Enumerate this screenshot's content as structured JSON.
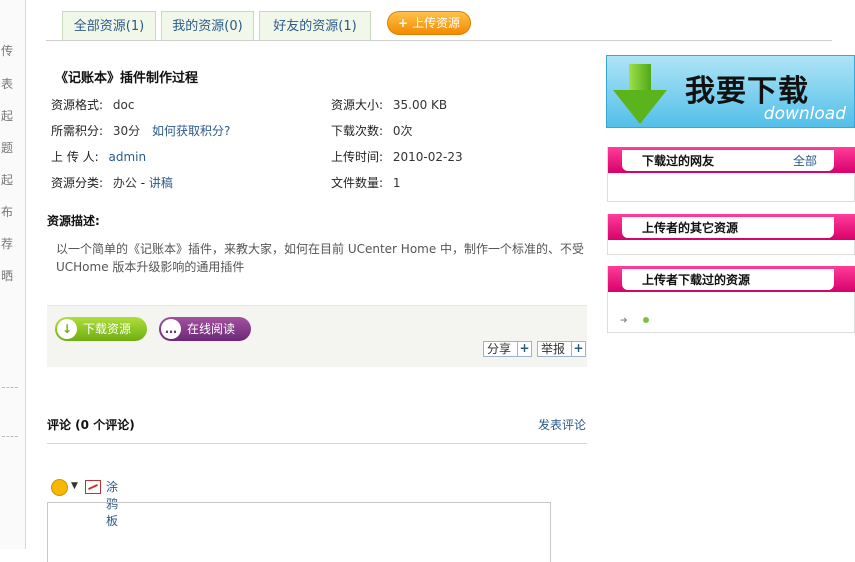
{
  "left_strip": {
    "chars": [
      "传",
      "表",
      "起",
      "题",
      "起",
      "布",
      "荐",
      "晒"
    ]
  },
  "tabs": [
    {
      "label": "全部资源(1)"
    },
    {
      "label": "我的资源(0)"
    },
    {
      "label": "好友的资源(1)"
    }
  ],
  "upload_button": {
    "label": "上传资源",
    "icon": "plus-icon"
  },
  "document": {
    "title": "《记账本》插件制作过程",
    "format_label": "资源格式:",
    "format_value": "doc",
    "size_label": "资源大小:",
    "size_value": "35.00 KB",
    "points_label": "所需积分:",
    "points_value": "30分",
    "points_link": "如何获取积分?",
    "downloads_label": "下载次数:",
    "downloads_value": "0次",
    "uploader_label": "上 传 人:",
    "uploader_value": "admin",
    "upload_time_label": "上传时间:",
    "upload_time_value": "2010-02-23",
    "category_label": "资源分类:",
    "category_value": "办公",
    "category_sep": " - ",
    "category_sub": "讲稿",
    "file_count_label": "文件数量:",
    "file_count_value": "1"
  },
  "description": {
    "title": "资源描述:",
    "text": "以一个简单的《记账本》插件，来教大家，如何在目前 UCenter Home 中，制作一个标准的、不受 UCHome 版本升级影响的通用插件"
  },
  "actions": {
    "download_label": "下载资源",
    "read_online_label": "在线阅读",
    "share_label": "分享",
    "report_label": "举报"
  },
  "comments": {
    "title": "评论 (0 个评论)",
    "post_link": "发表评论",
    "graffiti_label": "涂鸦板"
  },
  "sidebar": {
    "download_banner": {
      "text": "我要下载",
      "sub": "download"
    },
    "downloaders": {
      "title": "下载过的网友",
      "more": "全部"
    },
    "uploader_other": {
      "title": "上传者的其它资源"
    },
    "uploader_downloaded": {
      "title": "上传者下载过的资源"
    }
  },
  "colors": {
    "link": "#2b5a8a",
    "ribbon": "#d8006a",
    "upload_button": "#f48a00",
    "download_button": "#6fae10",
    "read_button": "#6d2878",
    "banner": "#53bfe8"
  }
}
